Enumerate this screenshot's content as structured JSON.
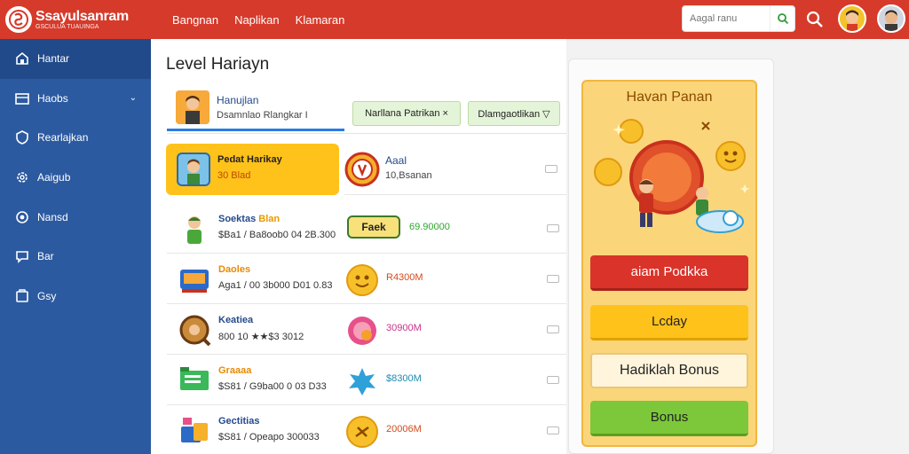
{
  "header": {
    "brand": "Ssayulsanram",
    "brand_sub": "GSCULUA TUAUINGA",
    "nav": [
      "Bangnan",
      "Naplikan",
      "Klamaran"
    ],
    "search_placeholder": "Aagal ranu"
  },
  "sidebar": {
    "items": [
      {
        "label": "Hantar",
        "icon": "home-icon"
      },
      {
        "label": "Haobs",
        "icon": "folder-icon"
      },
      {
        "label": "Rearlajkan",
        "icon": "shield-icon"
      },
      {
        "label": "Aaigub",
        "icon": "gear-icon"
      },
      {
        "label": "Nansd",
        "icon": "settings-icon"
      },
      {
        "label": "Bar",
        "icon": "chat-icon"
      },
      {
        "label": "Gsy",
        "icon": "box-icon"
      }
    ]
  },
  "main": {
    "title": "Level Hariayn",
    "profile": {
      "name": "Hanujlan",
      "sub": "Dsamnlao Rlangkar I"
    },
    "chips": [
      "Narllana Patrikan ×",
      "Dlamgaotlikan ▽"
    ],
    "highlight": {
      "name": "Pedat Harikay",
      "sub": "30 Blad"
    },
    "highlight_right": {
      "name": "Aaal",
      "sub": "10,Bsanan"
    },
    "rows": [
      {
        "name": "Soektas",
        "tag": "Blan",
        "sub": "$Ba1 / Ba8oob0 04 2B.300",
        "badge": "Faek",
        "amount": "69.90000",
        "amount_color": "#2fa52f"
      },
      {
        "name": "Daoles",
        "tag": "",
        "sub": "Aga1 / 00 3b000 D01 0.83",
        "badge": "",
        "amount": "R4300M",
        "amount_color": "#d34a1e"
      },
      {
        "name": "Keatiea",
        "tag": "",
        "sub": "800 10 ★★$3 3012",
        "badge": "",
        "amount": "30900M",
        "amount_color": "#c9328a"
      },
      {
        "name": "Graaaa",
        "tag": "",
        "sub": "$S81 / G9ba00 0 03 D33",
        "badge": "",
        "amount": "$8300M",
        "amount_color": "#1e8ab0"
      },
      {
        "name": "Gectitias",
        "tag": "",
        "sub": "$S81 / Opeapo 300033",
        "badge": "",
        "amount": "20006M",
        "amount_color": "#d34a1e"
      }
    ]
  },
  "panel": {
    "title": "Havan Panan",
    "buttons": [
      "aiam Podkka",
      "Lcday",
      "Hadiklah Bonus",
      "Bonus"
    ]
  }
}
